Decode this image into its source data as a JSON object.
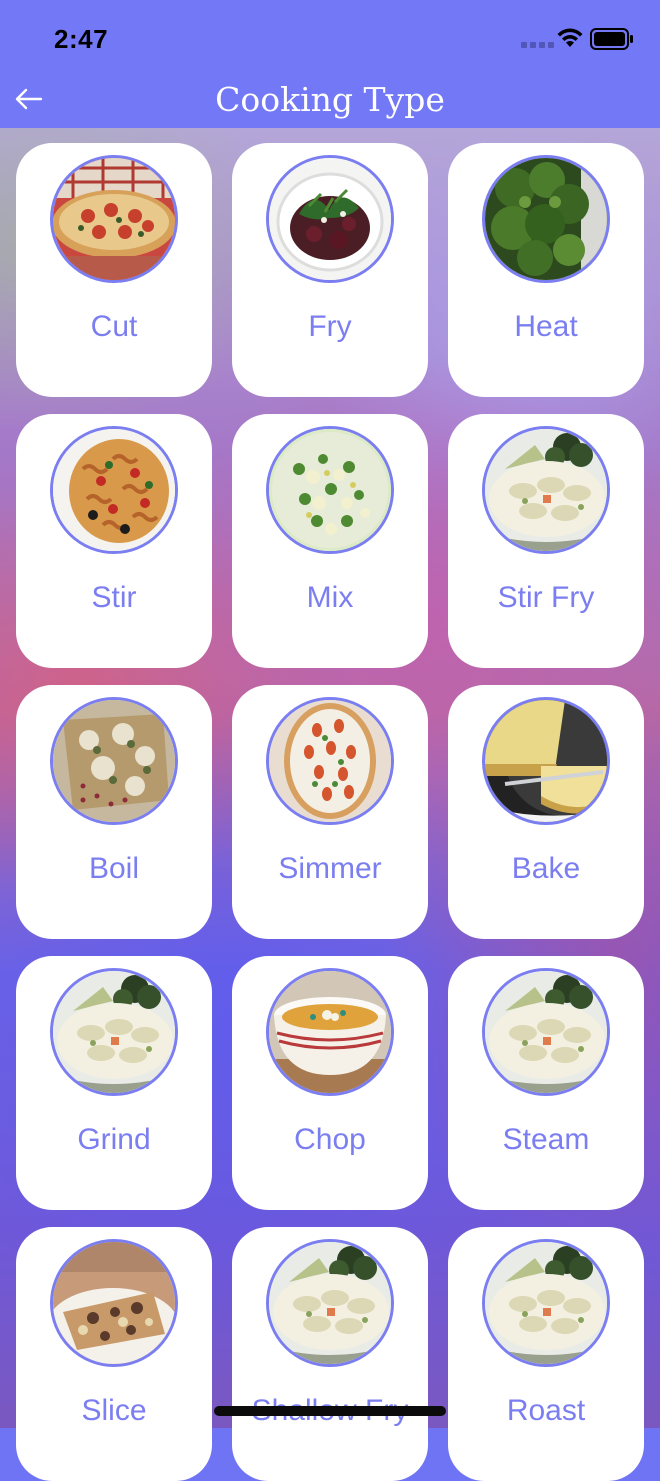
{
  "status": {
    "time": "2:47"
  },
  "header": {
    "title": "Cooking Type",
    "back_icon": "arrow-left-icon"
  },
  "theme": {
    "accent": "#7b7ef0",
    "bar": "#7379f6"
  },
  "cooking_types": [
    {
      "label": "Cut",
      "image": "pizza"
    },
    {
      "label": "Fry",
      "image": "beet-salad"
    },
    {
      "label": "Heat",
      "image": "broccoli"
    },
    {
      "label": "Stir",
      "image": "pasta-salad"
    },
    {
      "label": "Mix",
      "image": "herb-salad"
    },
    {
      "label": "Stir Fry",
      "image": "creamy-pasta"
    },
    {
      "label": "Boil",
      "image": "flatbread"
    },
    {
      "label": "Simmer",
      "image": "pizza-tomato"
    },
    {
      "label": "Bake",
      "image": "cornbread"
    },
    {
      "label": "Grind",
      "image": "creamy-pasta"
    },
    {
      "label": "Chop",
      "image": "soup-bowl"
    },
    {
      "label": "Steam",
      "image": "creamy-pasta"
    },
    {
      "label": "Slice",
      "image": "flatbread-slice"
    },
    {
      "label": "Shallow Fry",
      "image": "creamy-pasta"
    },
    {
      "label": "Roast",
      "image": "creamy-pasta"
    }
  ]
}
